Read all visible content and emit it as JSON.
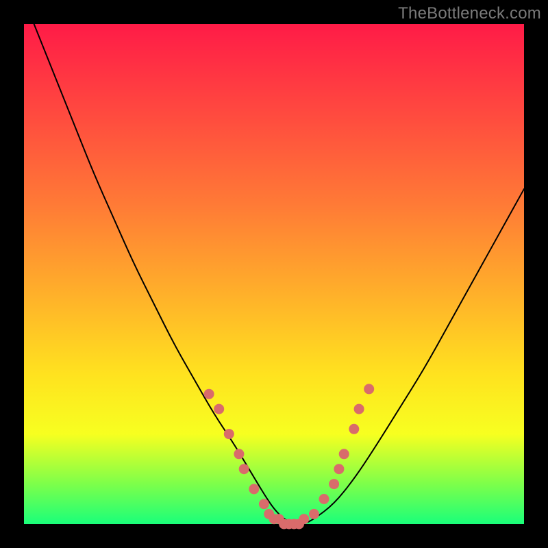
{
  "watermark": "TheBottleneck.com",
  "colors": {
    "bg_frame": "#000000",
    "gradient_top": "#ff1b47",
    "gradient_mid1": "#ff7a36",
    "gradient_mid2": "#ffe21f",
    "gradient_bottom": "#1aff7a",
    "curve": "#000000",
    "dots": "#d96b6b"
  },
  "chart_data": {
    "type": "line",
    "title": "",
    "xlabel": "",
    "ylabel": "",
    "xlim": [
      0,
      100
    ],
    "ylim": [
      0,
      100
    ],
    "grid": false,
    "legend": false,
    "series": [
      {
        "name": "bottleneck-curve",
        "x": [
          2,
          6,
          10,
          14,
          18,
          22,
          26,
          30,
          34,
          38,
          42,
          45,
          48,
          50,
          52,
          54,
          56,
          58,
          62,
          66,
          70,
          75,
          80,
          85,
          90,
          95,
          100
        ],
        "y": [
          100,
          90,
          80,
          70,
          61,
          52,
          44,
          36,
          29,
          22,
          16,
          11,
          6,
          3,
          1,
          0,
          0,
          1,
          4,
          9,
          15,
          23,
          31,
          40,
          49,
          58,
          67
        ]
      }
    ],
    "dots": {
      "name": "sample-points",
      "x_pct": [
        37,
        39,
        41,
        43,
        44,
        46,
        48,
        49,
        50,
        51,
        52,
        53,
        54,
        55,
        56,
        58,
        60,
        62,
        63,
        64,
        66,
        67,
        69
      ],
      "y_pct": [
        26,
        23,
        18,
        14,
        11,
        7,
        4,
        2,
        1,
        1,
        0,
        0,
        0,
        0,
        1,
        2,
        5,
        8,
        11,
        14,
        19,
        23,
        27
      ]
    }
  }
}
